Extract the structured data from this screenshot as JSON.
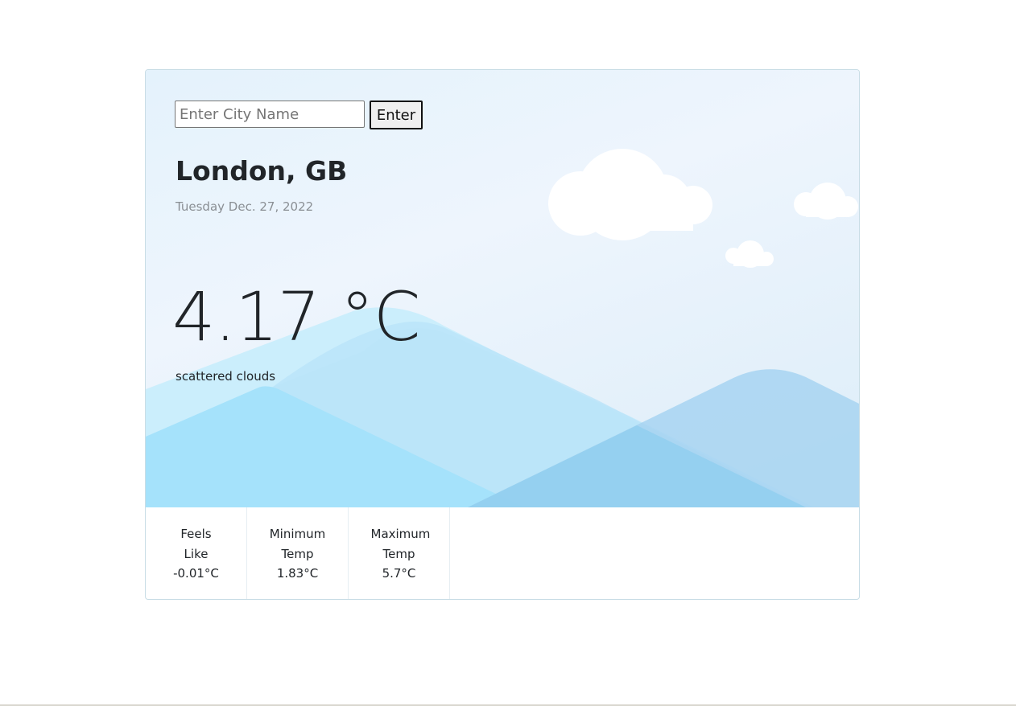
{
  "search": {
    "placeholder": "Enter City Name",
    "value": "",
    "button_label": "Enter"
  },
  "location": {
    "city": "London, GB",
    "date": "Tuesday Dec. 27, 2022"
  },
  "weather": {
    "temperature": "4.17 °C",
    "description": "scattered clouds"
  },
  "stats": [
    {
      "label": "Feels Like",
      "value": "-0.01°C"
    },
    {
      "label": "Minimum Temp",
      "value": "1.83°C"
    },
    {
      "label": "Maximum Temp",
      "value": "5.7°C"
    }
  ],
  "colors": {
    "sky_top": "#e4f2fc",
    "mountain_light": "#b8e6fb",
    "mountain_mid": "#a4ddf8",
    "mountain_dark": "#8fcdef",
    "cloud": "#ffffff"
  },
  "icons": [
    "cloud-icon",
    "mountain-illustration"
  ]
}
